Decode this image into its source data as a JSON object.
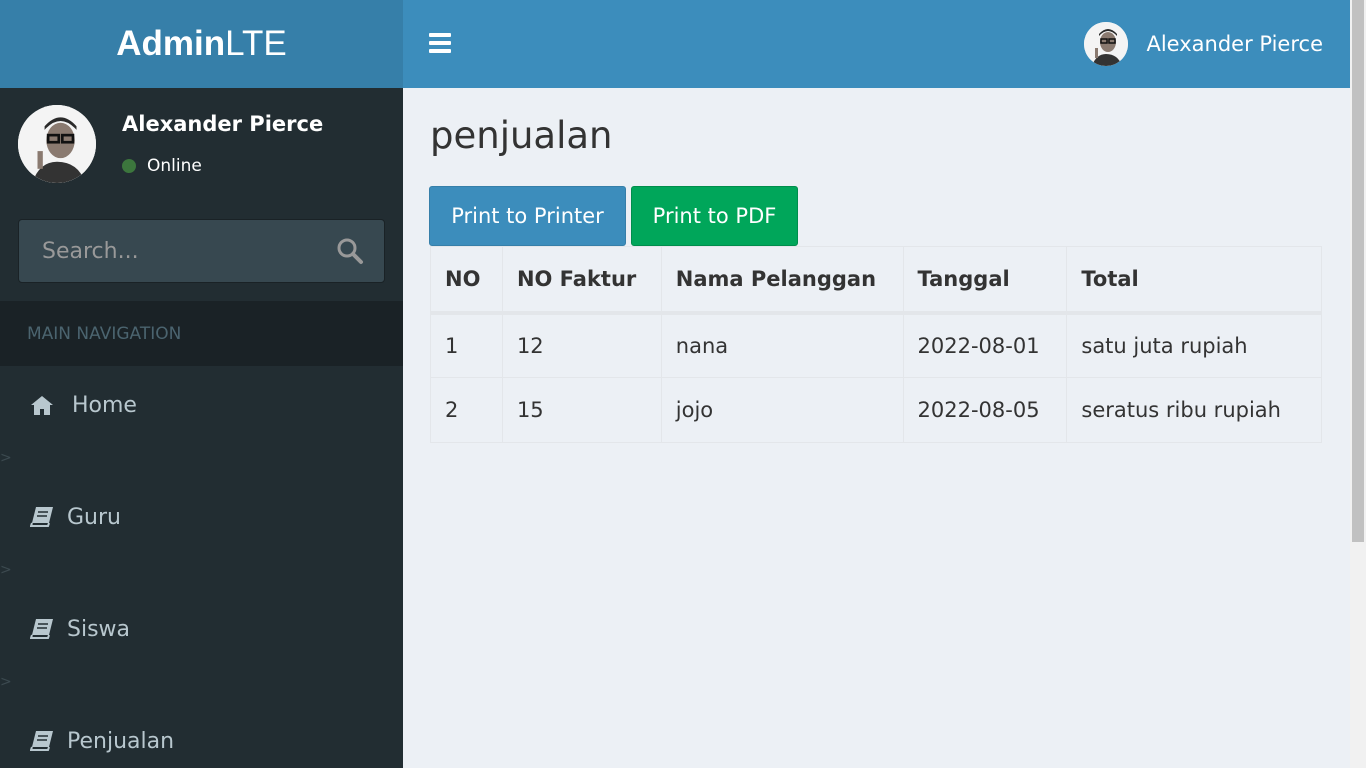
{
  "brand": {
    "bold": "Admin",
    "light": "LTE"
  },
  "header": {
    "user_name": "Alexander Pierce"
  },
  "sidebar": {
    "user_name": "Alexander Pierce",
    "status": "Online",
    "search_placeholder": "Search...",
    "nav_header": "MAIN NAVIGATION",
    "items": [
      {
        "label": "Home",
        "icon": "home-icon"
      },
      {
        "label": "Guru",
        "icon": "book-icon"
      },
      {
        "label": "Siswa",
        "icon": "book-icon"
      },
      {
        "label": "Penjualan",
        "icon": "book-icon"
      }
    ],
    "stray_marks": [
      ">",
      ">",
      ">"
    ]
  },
  "content": {
    "title": "penjualan",
    "buttons": {
      "printer": "Print to Printer",
      "pdf": "Print to PDF"
    },
    "table": {
      "headers": [
        "NO",
        "NO Faktur",
        "Nama Pelanggan",
        "Tanggal",
        "Total"
      ],
      "rows": [
        [
          "1",
          "12",
          "nana",
          "2022-08-01",
          "satu juta rupiah"
        ],
        [
          "2",
          "15",
          "jojo",
          "2022-08-05",
          "seratus ribu rupiah"
        ]
      ]
    }
  },
  "colors": {
    "primary": "#3c8dbc",
    "success": "#00a65a",
    "sidebar": "#222d32",
    "online": "#3c763d"
  }
}
